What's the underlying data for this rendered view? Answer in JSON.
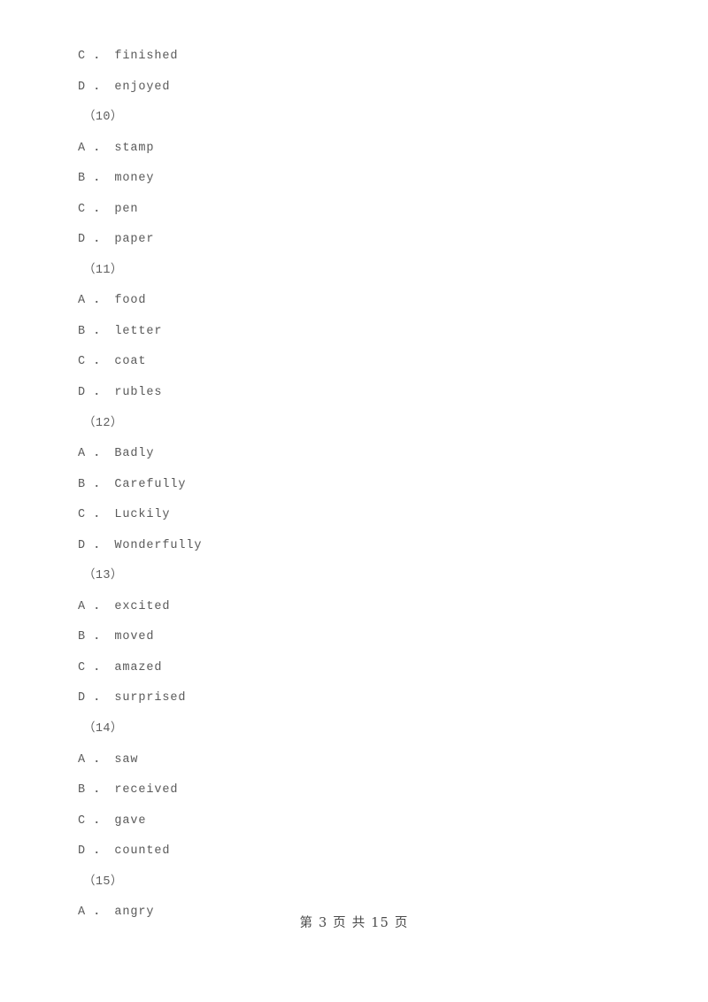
{
  "document": {
    "type": "exam-paper",
    "language": "en-within-zh",
    "page_number": 3,
    "total_pages": 15
  },
  "lines": [
    {
      "kind": "option",
      "text": "C ． finished"
    },
    {
      "kind": "option",
      "text": "D ． enjoyed"
    },
    {
      "kind": "question",
      "text": "（10）"
    },
    {
      "kind": "option",
      "text": "A ． stamp"
    },
    {
      "kind": "option",
      "text": "B ． money"
    },
    {
      "kind": "option",
      "text": "C ． pen"
    },
    {
      "kind": "option",
      "text": "D ． paper"
    },
    {
      "kind": "question",
      "text": "（11）"
    },
    {
      "kind": "option",
      "text": "A ． food"
    },
    {
      "kind": "option",
      "text": "B ． letter"
    },
    {
      "kind": "option",
      "text": "C ． coat"
    },
    {
      "kind": "option",
      "text": "D ． rubles"
    },
    {
      "kind": "question",
      "text": "（12）"
    },
    {
      "kind": "option",
      "text": "A ． Badly"
    },
    {
      "kind": "option",
      "text": "B ． Carefully"
    },
    {
      "kind": "option",
      "text": "C ． Luckily"
    },
    {
      "kind": "option",
      "text": "D ． Wonderfully"
    },
    {
      "kind": "question",
      "text": "（13）"
    },
    {
      "kind": "option",
      "text": "A ． excited"
    },
    {
      "kind": "option",
      "text": "B ． moved"
    },
    {
      "kind": "option",
      "text": "C ． amazed"
    },
    {
      "kind": "option",
      "text": "D ． surprised"
    },
    {
      "kind": "question",
      "text": "（14）"
    },
    {
      "kind": "option",
      "text": "A ． saw"
    },
    {
      "kind": "option",
      "text": "B ． received"
    },
    {
      "kind": "option",
      "text": "C ． gave"
    },
    {
      "kind": "option",
      "text": "D ． counted"
    },
    {
      "kind": "question",
      "text": "（15）"
    },
    {
      "kind": "option",
      "text": "A ． angry"
    }
  ],
  "footer": {
    "text": "第 3 页 共 15 页"
  },
  "colors": {
    "page_background": "#ffffff",
    "body_text": "#5b5b5b",
    "footer_text": "#4a4a4a"
  }
}
